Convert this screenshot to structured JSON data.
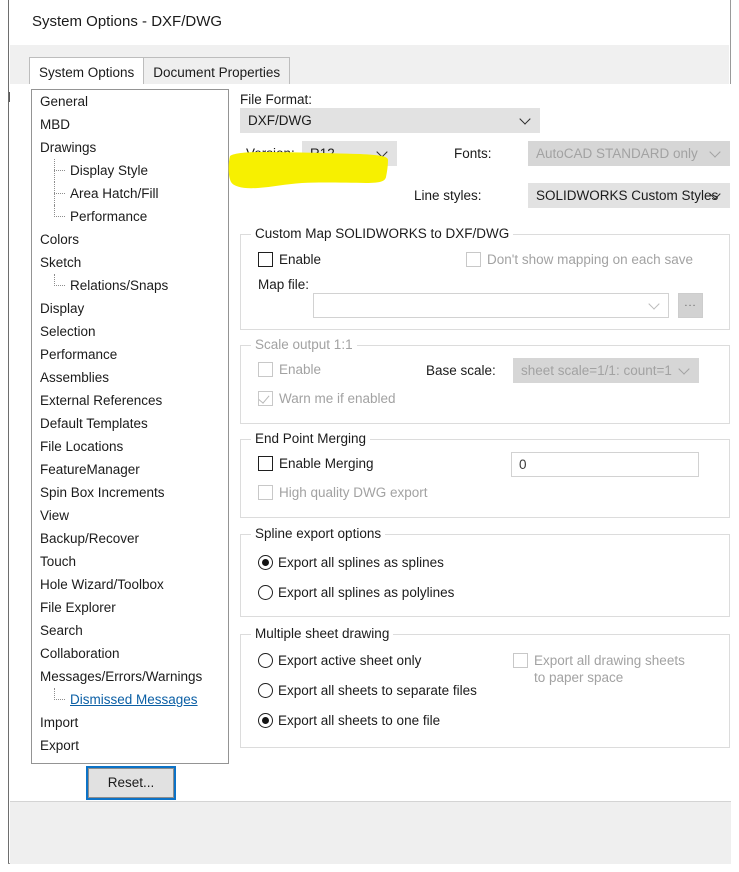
{
  "window": {
    "title": "System Options - DXF/DWG"
  },
  "tabs": [
    {
      "label": "System Options",
      "active": true
    },
    {
      "label": "Document Properties",
      "active": false
    }
  ],
  "sidebar": {
    "items": [
      {
        "label": "General",
        "level": 0
      },
      {
        "label": "MBD",
        "level": 0
      },
      {
        "label": "Drawings",
        "level": 0
      },
      {
        "label": "Display Style",
        "level": 1
      },
      {
        "label": "Area Hatch/Fill",
        "level": 1
      },
      {
        "label": "Performance",
        "level": 1
      },
      {
        "label": "Colors",
        "level": 0
      },
      {
        "label": "Sketch",
        "level": 0
      },
      {
        "label": "Relations/Snaps",
        "level": 1
      },
      {
        "label": "Display",
        "level": 0
      },
      {
        "label": "Selection",
        "level": 0
      },
      {
        "label": "Performance",
        "level": 0
      },
      {
        "label": "Assemblies",
        "level": 0
      },
      {
        "label": "External References",
        "level": 0
      },
      {
        "label": "Default Templates",
        "level": 0
      },
      {
        "label": "File Locations",
        "level": 0
      },
      {
        "label": "FeatureManager",
        "level": 0
      },
      {
        "label": "Spin Box Increments",
        "level": 0
      },
      {
        "label": "View",
        "level": 0
      },
      {
        "label": "Backup/Recover",
        "level": 0
      },
      {
        "label": "Touch",
        "level": 0
      },
      {
        "label": "Hole Wizard/Toolbox",
        "level": 0
      },
      {
        "label": "File Explorer",
        "level": 0
      },
      {
        "label": "Search",
        "level": 0
      },
      {
        "label": "Collaboration",
        "level": 0
      },
      {
        "label": "Messages/Errors/Warnings",
        "level": 0
      },
      {
        "label": "Dismissed Messages",
        "level": 1,
        "link": true
      },
      {
        "label": "Import",
        "level": 0
      },
      {
        "label": "Export",
        "level": 0
      }
    ]
  },
  "main": {
    "file_format_label": "File Format:",
    "file_format_value": "DXF/DWG",
    "version_label": "Version:",
    "version_value": "R12",
    "fonts_label": "Fonts:",
    "fonts_value": "AutoCAD STANDARD only",
    "line_styles_label": "Line styles:",
    "line_styles_value": "SOLIDWORKS Custom Styles",
    "custom_map": {
      "caption": "Custom Map SOLIDWORKS to DXF/DWG",
      "enable_label": "Enable",
      "dont_show_label": "Don't show mapping on each save",
      "map_file_label": "Map file:",
      "map_file_value": "",
      "browse_label": "..."
    },
    "scale_output": {
      "caption": "Scale output 1:1",
      "enable_label": "Enable",
      "warn_label": "Warn me if enabled",
      "base_scale_label": "Base scale:",
      "base_scale_value": "sheet scale=1/1: count=1"
    },
    "end_point_merging": {
      "caption": "End Point Merging",
      "enable_label": "Enable Merging",
      "value": "0",
      "high_quality_label": "High quality DWG export"
    },
    "spline_export": {
      "caption": "Spline export options",
      "option_splines": "Export all splines as splines",
      "option_polylines": "Export all splines as polylines"
    },
    "multiple_sheet": {
      "caption": "Multiple sheet drawing",
      "option_active": "Export active sheet only",
      "option_separate": "Export all sheets to separate files",
      "option_one": "Export all sheets to one file",
      "paper_space_label": "Export all drawing sheets to paper space"
    },
    "reset_label": "Reset..."
  },
  "annotation": {
    "highlight_color": "#f7f000",
    "target": "version-row"
  },
  "colors": {
    "link": "#0b5fa5",
    "focus_ring": "#0c72c6",
    "combo_bg": "#e2e2e2",
    "combo_disabled_bg": "#d6d6d6",
    "disabled_text": "#a2a2a2",
    "footer_bg": "#efefef"
  }
}
